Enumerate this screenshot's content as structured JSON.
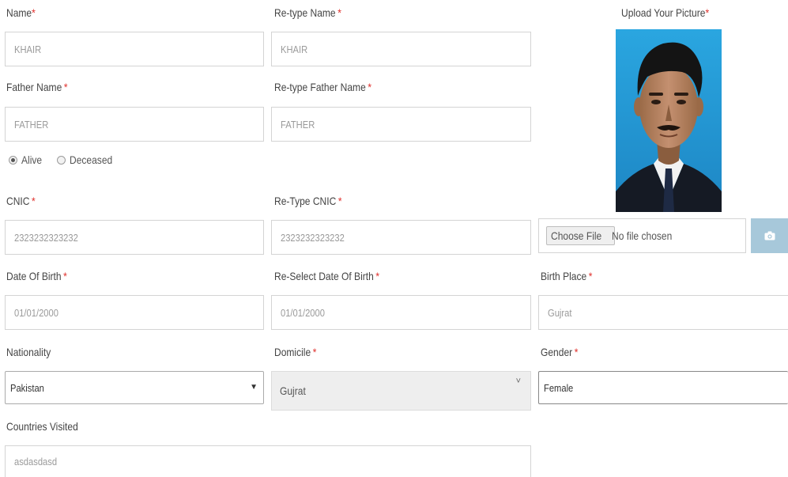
{
  "form": {
    "name": {
      "label": "Name",
      "value": "KHAIR"
    },
    "retype_name": {
      "label": "Re-type Name",
      "value": "KHAIR"
    },
    "father_name": {
      "label": "Father Name",
      "value": "FATHER"
    },
    "retype_father_name": {
      "label": "Re-type Father Name",
      "value": "FATHER"
    },
    "father_status": {
      "options": [
        "Alive",
        "Deceased"
      ],
      "selected": "Alive"
    },
    "cnic": {
      "label": "CNIC",
      "value": "2323232323232"
    },
    "retype_cnic": {
      "label": "Re-Type CNIC",
      "value": "2323232323232"
    },
    "dob": {
      "label": "Date Of Birth",
      "value": "01/01/2000"
    },
    "reselect_dob": {
      "label": "Re-Select Date Of Birth",
      "value": "01/01/2000"
    },
    "birth_place": {
      "label": "Birth Place",
      "value": "Gujrat"
    },
    "nationality": {
      "label": "Nationality",
      "value": "Pakistan"
    },
    "domicile": {
      "label": "Domicile",
      "value": "Gujrat"
    },
    "gender": {
      "label": "Gender",
      "value": "Female"
    },
    "countries_visited": {
      "label": "Countries Visited",
      "value": "asdasdasd"
    },
    "required_mark": "*"
  },
  "upload": {
    "label": "Upload Your Picture",
    "choose_button": "Choose File",
    "file_status": "No file chosen",
    "camera_icon": "camera-icon"
  },
  "colors": {
    "required": "#e0322e",
    "upload_button": "#a7c8da",
    "photo_background": "#2a9fd8"
  }
}
